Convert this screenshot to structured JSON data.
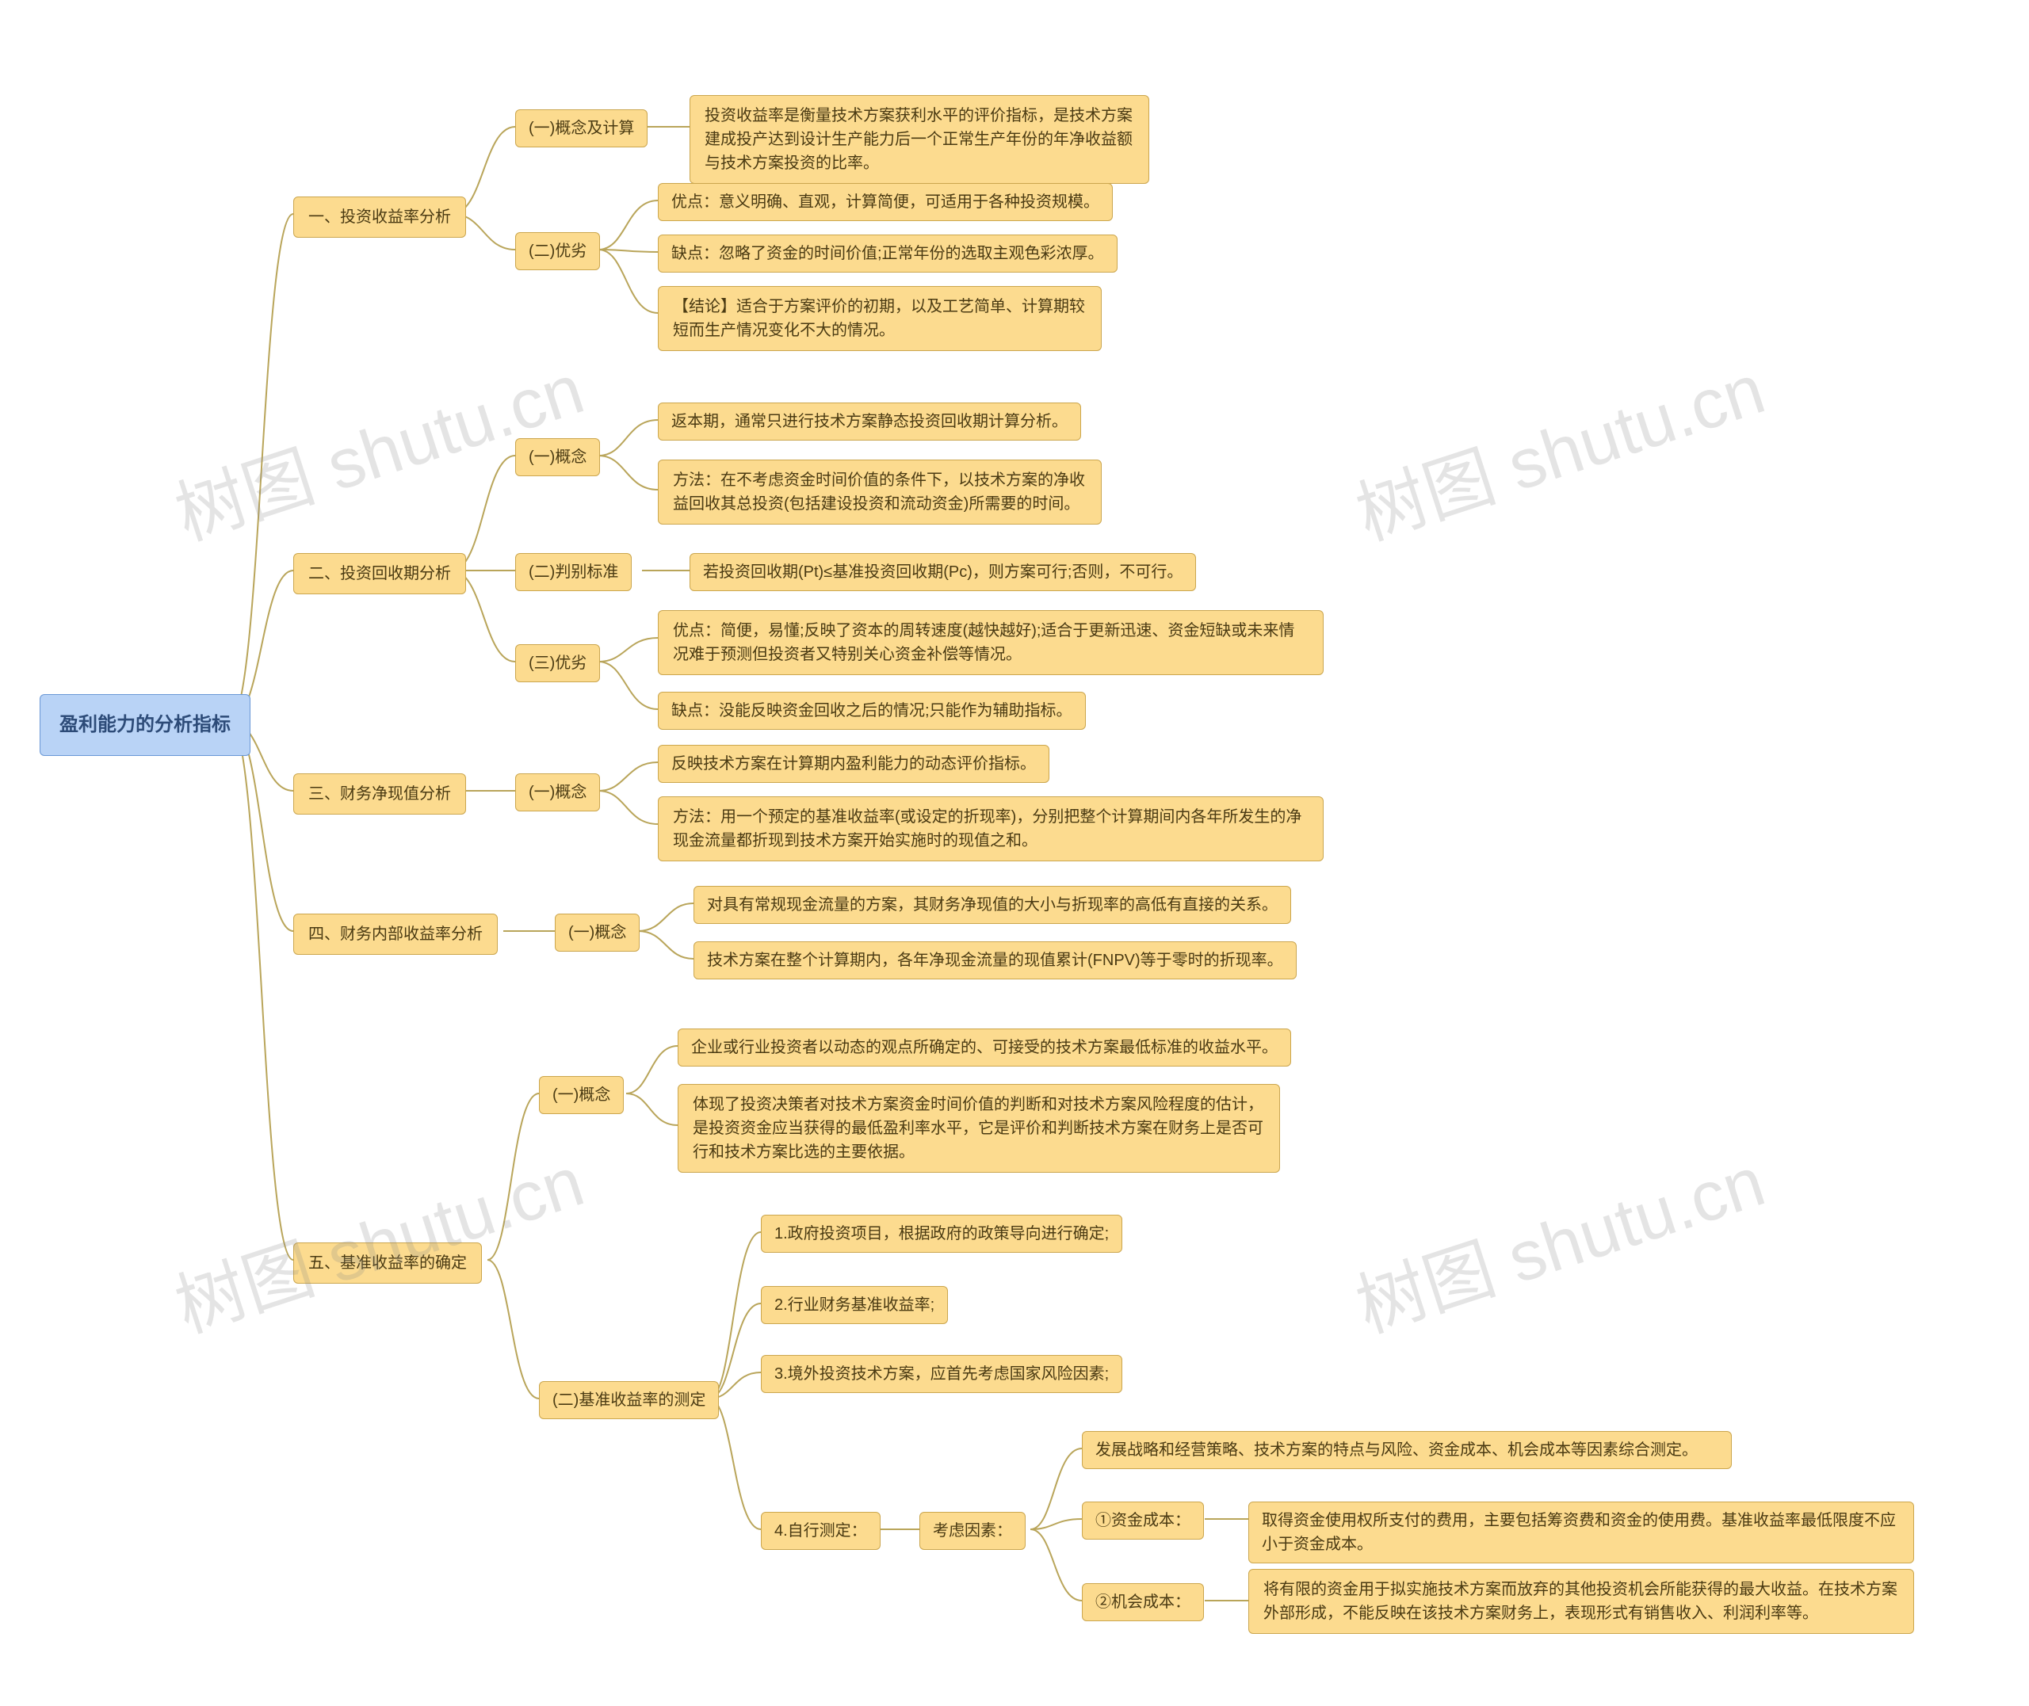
{
  "root": {
    "title": "盈利能力的分析指标"
  },
  "branches": [
    {
      "label": "一、投资收益率分析",
      "children": [
        {
          "label": "(一)概念及计算",
          "children": [
            {
              "text": "投资收益率是衡量技术方案获利水平的评价指标，是技术方案建成投产达到设计生产能力后一个正常生产年份的年净收益额与技术方案投资的比率。"
            }
          ]
        },
        {
          "label": "(二)优劣",
          "children": [
            {
              "text": "优点：意义明确、直观，计算简便，可适用于各种投资规模。"
            },
            {
              "text": "缺点：忽略了资金的时间价值;正常年份的选取主观色彩浓厚。"
            },
            {
              "text": "【结论】适合于方案评价的初期，以及工艺简单、计算期较短而生产情况变化不大的情况。"
            }
          ]
        }
      ]
    },
    {
      "label": "二、投资回收期分析",
      "children": [
        {
          "label": "(一)概念",
          "children": [
            {
              "text": "返本期，通常只进行技术方案静态投资回收期计算分析。"
            },
            {
              "text": "方法：在不考虑资金时间价值的条件下，以技术方案的净收益回收其总投资(包括建设投资和流动资金)所需要的时间。"
            }
          ]
        },
        {
          "label": "(二)判别标准",
          "children": [
            {
              "text": "若投资回收期(Pt)≤基准投资回收期(Pc)，则方案可行;否则，不可行。"
            }
          ]
        },
        {
          "label": "(三)优劣",
          "children": [
            {
              "text": "优点：简便，易懂;反映了资本的周转速度(越快越好);适合于更新迅速、资金短缺或未来情况难于预测但投资者又特别关心资金补偿等情况。"
            },
            {
              "text": "缺点：没能反映资金回收之后的情况;只能作为辅助指标。"
            }
          ]
        }
      ]
    },
    {
      "label": "三、财务净现值分析",
      "children": [
        {
          "label": "(一)概念",
          "children": [
            {
              "text": "反映技术方案在计算期内盈利能力的动态评价指标。"
            },
            {
              "text": "方法：用一个预定的基准收益率(或设定的折现率)，分别把整个计算期间内各年所发生的净现金流量都折现到技术方案开始实施时的现值之和。"
            }
          ]
        }
      ]
    },
    {
      "label": "四、财务内部收益率分析",
      "children": [
        {
          "label": "(一)概念",
          "children": [
            {
              "text": "对具有常规现金流量的方案，其财务净现值的大小与折现率的高低有直接的关系。"
            },
            {
              "text": "技术方案在整个计算期内，各年净现金流量的现值累计(FNPV)等于零时的折现率。"
            }
          ]
        }
      ]
    },
    {
      "label": "五、基准收益率的确定",
      "children": [
        {
          "label": "(一)概念",
          "children": [
            {
              "text": "企业或行业投资者以动态的观点所确定的、可接受的技术方案最低标准的收益水平。"
            },
            {
              "text": "体现了投资决策者对技术方案资金时间价值的判断和对技术方案风险程度的估计，是投资资金应当获得的最低盈利率水平，它是评价和判断技术方案在财务上是否可行和技术方案比选的主要依据。"
            }
          ]
        },
        {
          "label": "(二)基准收益率的测定",
          "children": [
            {
              "text": "1.政府投资项目，根据政府的政策导向进行确定;"
            },
            {
              "text": "2.行业财务基准收益率;"
            },
            {
              "text": "3.境外投资技术方案，应首先考虑国家风险因素;"
            },
            {
              "text": "4.自行测定：",
              "children": [
                {
                  "text": "考虑因素：",
                  "children": [
                    {
                      "text": "发展战略和经营策略、技术方案的特点与风险、资金成本、机会成本等因素综合测定。"
                    },
                    {
                      "text": "①资金成本：",
                      "children": [
                        {
                          "text": "取得资金使用权所支付的费用，主要包括筹资费和资金的使用费。基准收益率最低限度不应小于资金成本。"
                        }
                      ]
                    },
                    {
                      "text": "②机会成本：",
                      "children": [
                        {
                          "text": "将有限的资金用于拟实施技术方案而放弃的其他投资机会所能获得的最大收益。在技术方案外部形成，不能反映在该技术方案财务上，表现形式有销售收入、利润利率等。"
                        }
                      ]
                    }
                  ]
                }
              ]
            }
          ]
        }
      ]
    }
  ],
  "watermarks": {
    "text": "树图 shutu.cn"
  }
}
